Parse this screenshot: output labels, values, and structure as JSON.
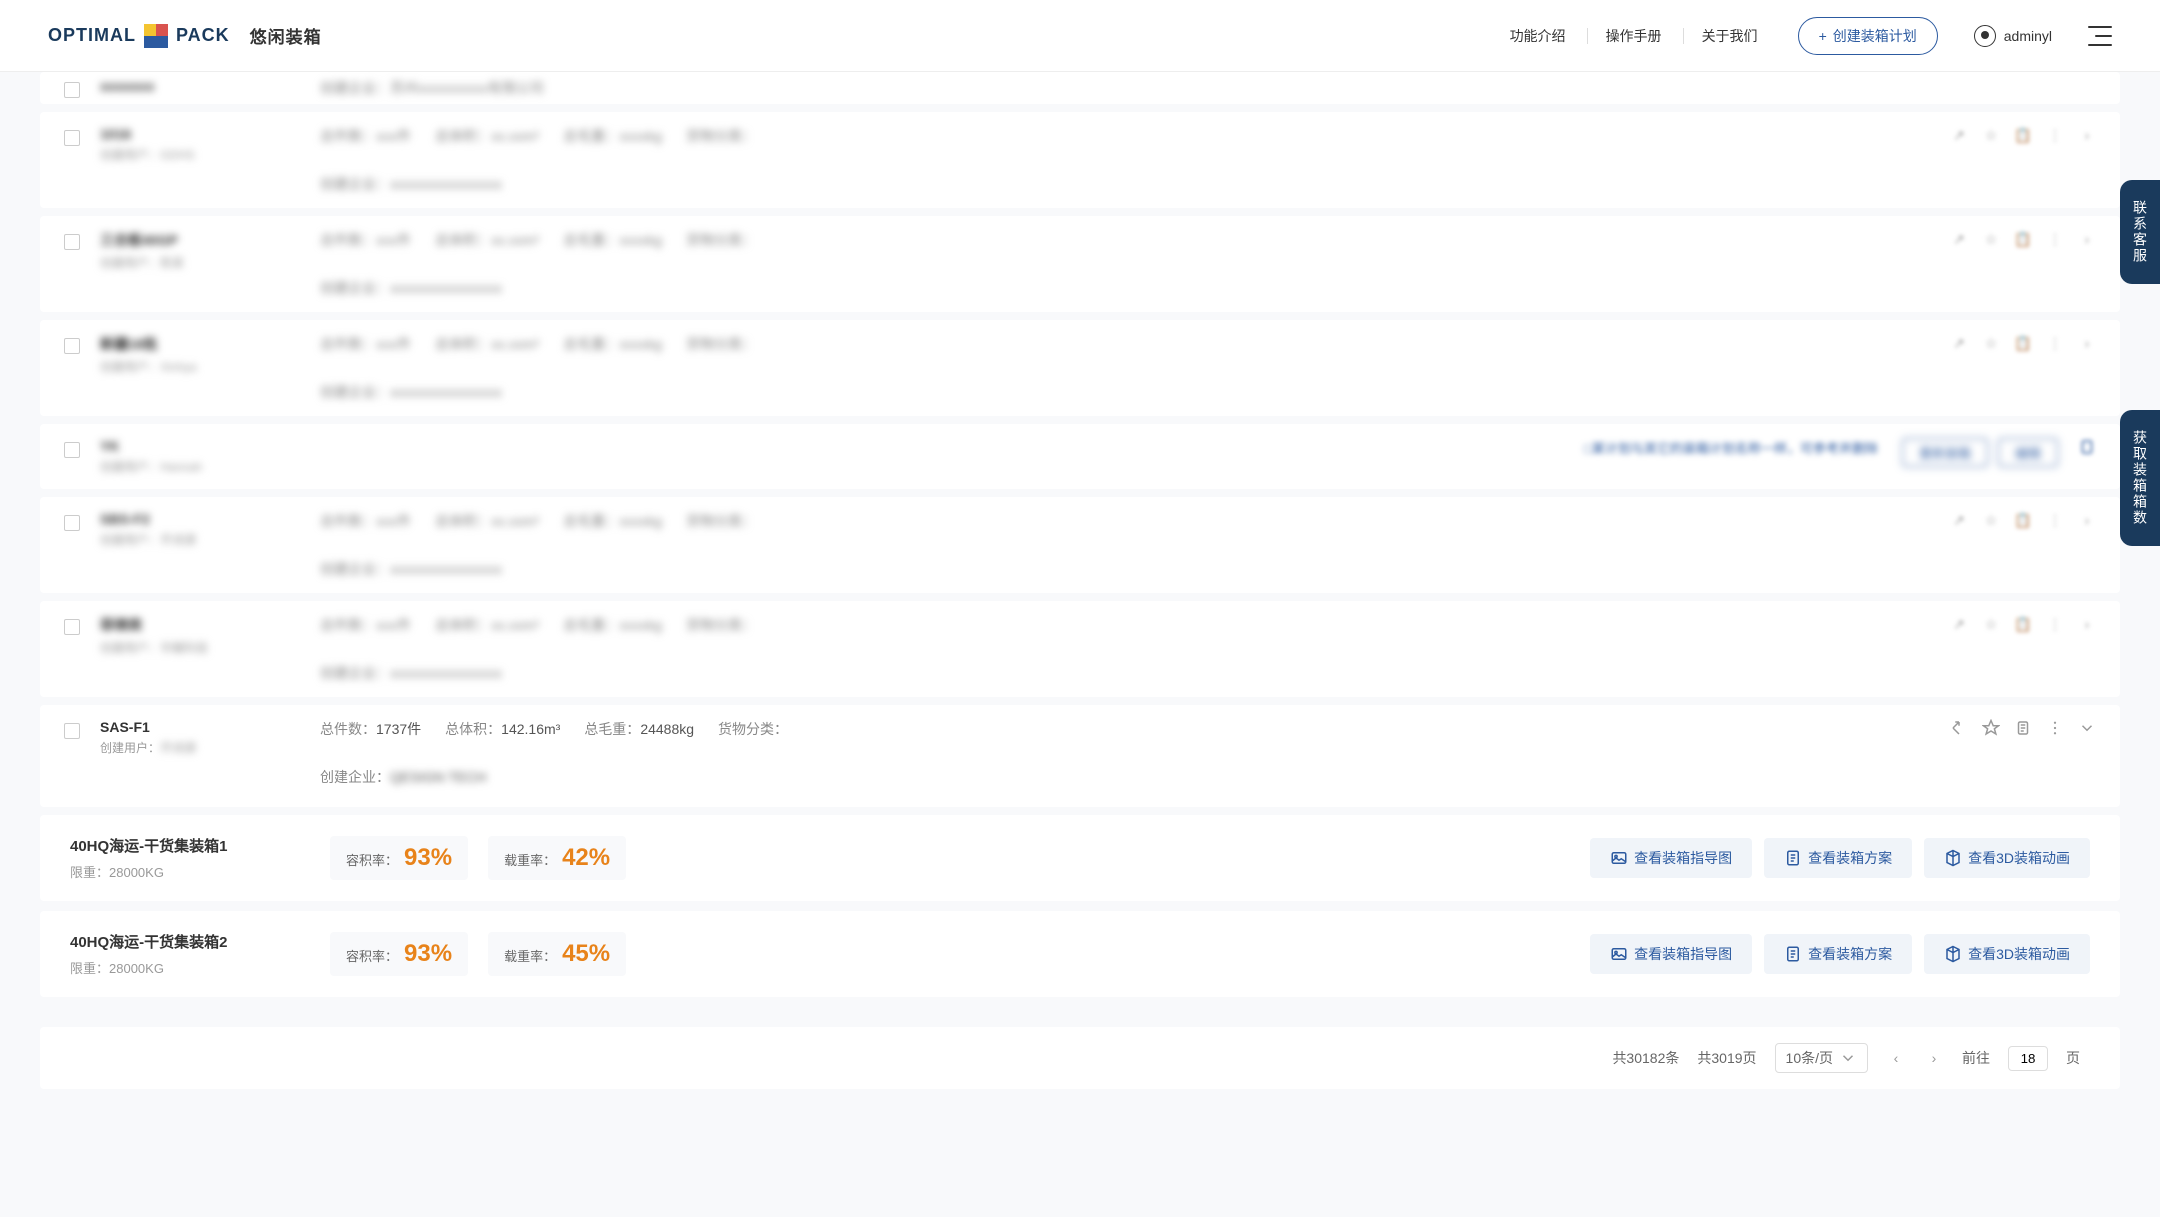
{
  "brand": {
    "name": "OPTIMAL",
    "name2": "PACK",
    "sub": "悠闲装箱"
  },
  "nav": {
    "features": "功能介绍",
    "manual": "操作手册",
    "about": "关于我们",
    "create": "创建装箱计划",
    "username": "adminyl"
  },
  "blurred_rows": [
    {
      "title": "1016",
      "sub": "创建用户：GDHS"
    },
    {
      "title": "三合板40GP",
      "sub": "创建用户：陈某"
    },
    {
      "title": "新疆18批",
      "sub": "创建用户：Xinhya"
    },
    {
      "title": "YK",
      "sub": "创建用户：Hannah",
      "special": true
    },
    {
      "title": "SBS-F2",
      "sub": "创建用户：齐诗源"
    },
    {
      "title": "菲律宾",
      "sub": "创建用户：华耀科技"
    }
  ],
  "focus_row": {
    "title": "SAS-F1",
    "creator_label": "创建用户：",
    "creator_value": "齐诗源",
    "stats": {
      "count_label": "总件数：",
      "count": "1737件",
      "volume_label": "总体积：",
      "volume": "142.16m³",
      "weight_label": "总毛重：",
      "weight": "24488kg",
      "category_label": "货物分类：",
      "category": ""
    },
    "company_label": "创建企业：",
    "company_value": "QESIGN TECH"
  },
  "containers": [
    {
      "name": "40HQ海运-干货集装箱1",
      "limit_label": "限重：",
      "limit": "28000KG",
      "cap_label": "容积率：",
      "cap": "93%",
      "load_label": "载重率：",
      "load": "42%"
    },
    {
      "name": "40HQ海运-干货集装箱2",
      "limit_label": "限重：",
      "limit": "28000KG",
      "cap_label": "容积率：",
      "cap": "93%",
      "load_label": "载重率：",
      "load": "45%"
    }
  ],
  "buttons": {
    "guide": "查看装箱指导图",
    "plan": "查看装箱方案",
    "view3d": "查看3D装箱动画"
  },
  "pagination": {
    "total": "共30182条",
    "pages": "共3019页",
    "per_page": "10条/页",
    "goto_label": "前往",
    "page_value": "18",
    "page_suffix": "页"
  },
  "side": {
    "contact": "联系客服",
    "boxes": "获取装箱箱数"
  }
}
